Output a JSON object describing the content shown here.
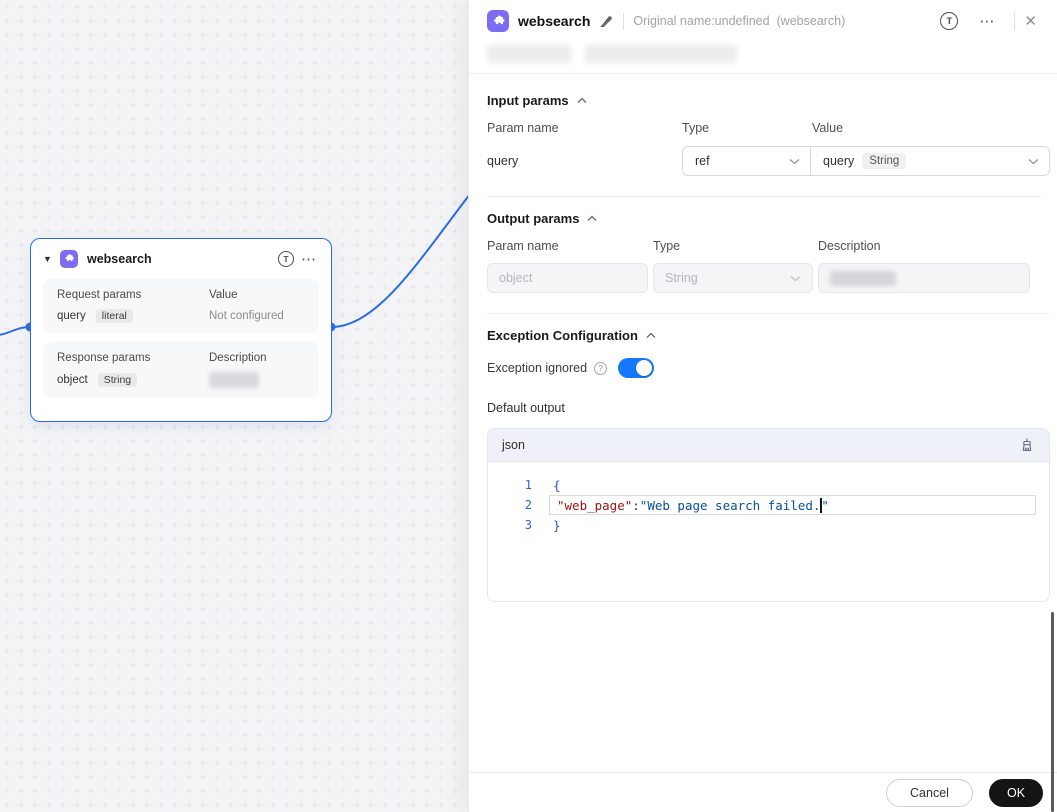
{
  "icons": {
    "more": "⋯",
    "close": "✕",
    "letter_t": "T",
    "help": "?",
    "collapse_caret": "▼"
  },
  "panel_header": {
    "title": "websearch",
    "subtitle": "Original name:undefined  (websearch)"
  },
  "input_params": {
    "title": "Input params",
    "col_param": "Param name",
    "col_type": "Type",
    "col_value": "Value",
    "row": {
      "name": "query",
      "type": "ref",
      "value_param": "query",
      "value_type": "String"
    }
  },
  "output_params": {
    "title": "Output params",
    "col_param": "Param name",
    "col_type": "Type",
    "col_desc": "Description",
    "row": {
      "name": "object",
      "type": "String"
    }
  },
  "exception": {
    "title": "Exception Configuration",
    "toggle_label": "Exception ignored",
    "toggle_on": true,
    "default_output_label": "Default output"
  },
  "editor": {
    "language": "json",
    "line1_num": "1",
    "line1": "{",
    "line2_num": "2",
    "line2_key": "\"web_page\"",
    "line2_colon": ":",
    "line2_value": "\"Web page search failed.",
    "line2_close": "\"",
    "line3_num": "3",
    "line3": "}"
  },
  "footer": {
    "cancel": "Cancel",
    "ok": "OK"
  },
  "node": {
    "title": "websearch",
    "request_title": "Request params",
    "request_col2": "Value",
    "request_param": "query",
    "request_badge": "literal",
    "request_value": "Not configured",
    "response_title": "Response params",
    "response_col2": "Description",
    "response_param": "object",
    "response_badge": "String"
  },
  "colors": {
    "accent": "#2b6ce8",
    "node_icon": "#7c6cf4",
    "toggle_on": "#1677ff"
  }
}
